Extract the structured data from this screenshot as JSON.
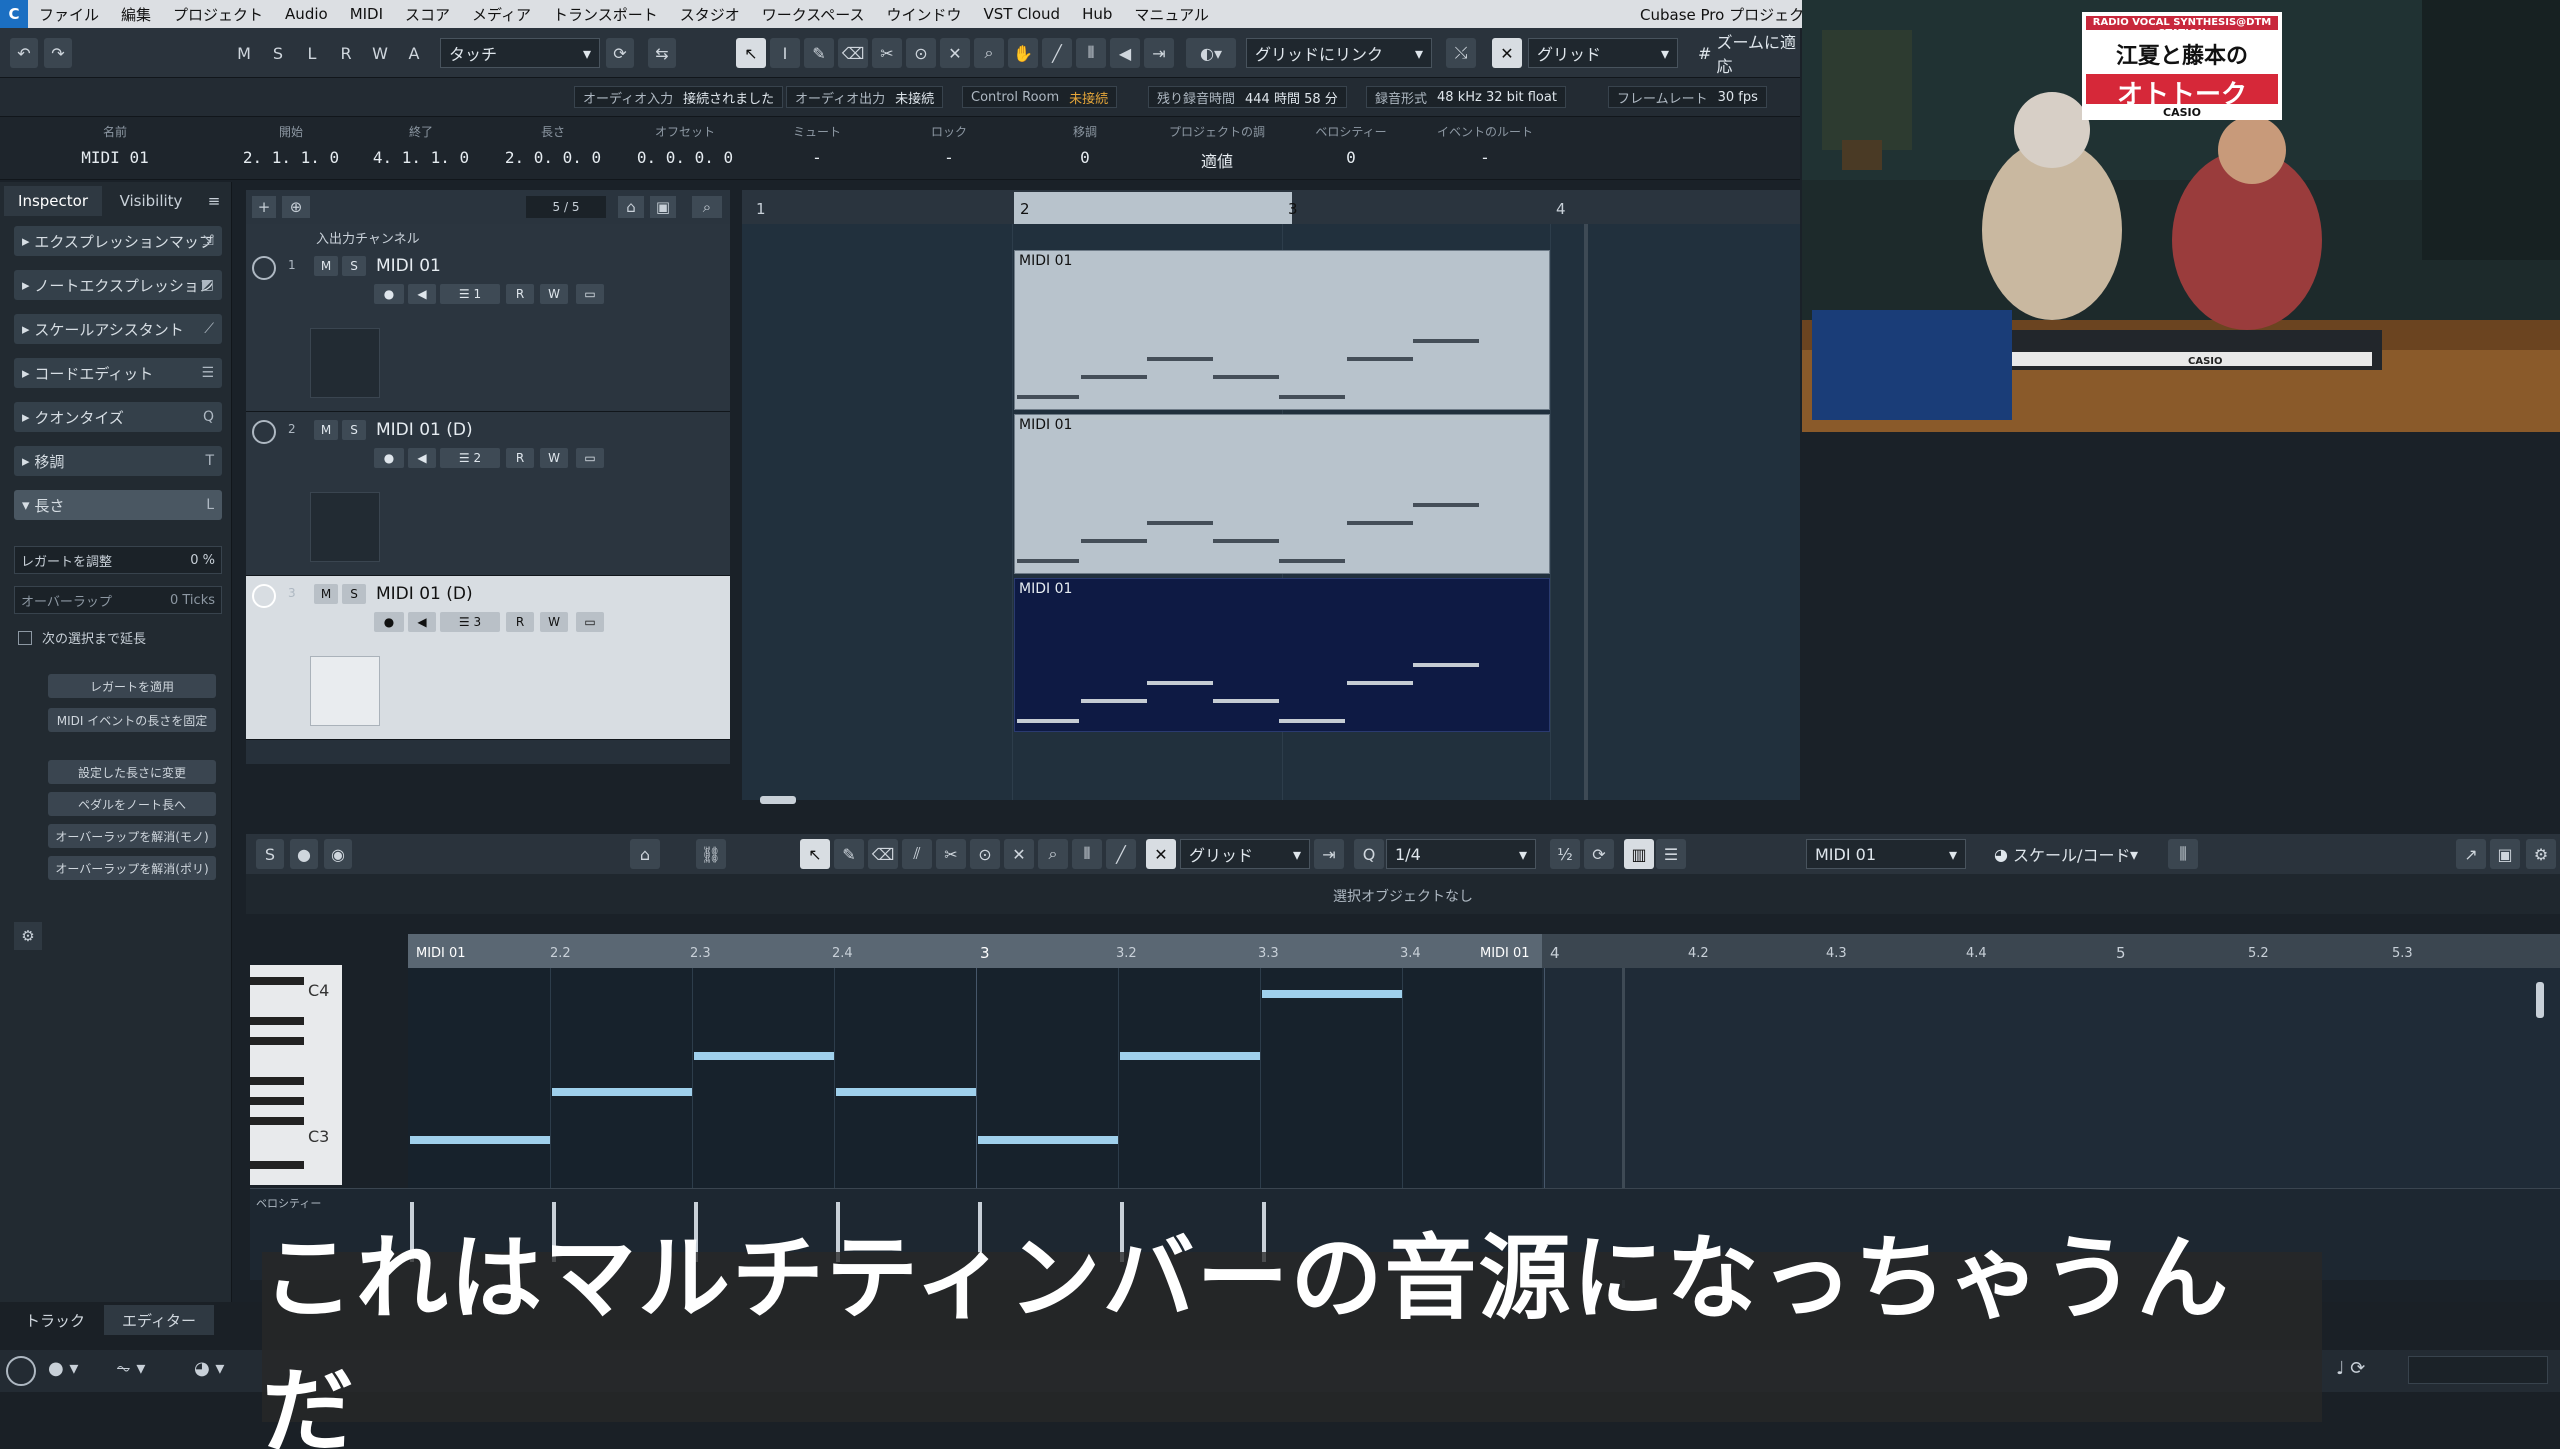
{
  "menubar": {
    "items": [
      "ファイル",
      "編集",
      "プロジェクト",
      "Audio",
      "MIDI",
      "スコア",
      "メディア",
      "トランスポート",
      "スタジオ",
      "ワークスペース",
      "ウインドウ",
      "VST Cloud",
      "Hub",
      "マニュアル"
    ],
    "app_title": "Cubase Pro プロジェクト"
  },
  "toolbar": {
    "state_buttons": [
      "M",
      "S",
      "L",
      "R",
      "W",
      "A"
    ],
    "automation_mode": "タッチ",
    "snap_mode": "グリッドにリンク",
    "grid_type": "グリッド",
    "zoom_label": "ズームに適応"
  },
  "status_line": [
    {
      "label": "オーディオ入力",
      "value": "接続されました",
      "warn": false
    },
    {
      "label": "オーディオ出力",
      "value": "未接続",
      "warn": false
    },
    {
      "label": "Control Room",
      "value": "未接続",
      "warn": true
    },
    {
      "label": "残り録音時間",
      "value": "444 時間 58 分",
      "warn": false
    },
    {
      "label": "録音形式",
      "value": "48 kHz  32 bit float",
      "warn": false
    },
    {
      "label": "フレームレート",
      "value": "30 fps",
      "warn": false
    }
  ],
  "infoline": [
    {
      "label": "名前",
      "value": "MIDI 01"
    },
    {
      "label": "開始",
      "value": "2. 1. 1.  0"
    },
    {
      "label": "終了",
      "value": "4. 1. 1.  0"
    },
    {
      "label": "長さ",
      "value": "2. 0. 0.  0"
    },
    {
      "label": "オフセット",
      "value": "0. 0. 0.  0"
    },
    {
      "label": "ミュート",
      "value": "-"
    },
    {
      "label": "ロック",
      "value": "-"
    },
    {
      "label": "移調",
      "value": "0"
    },
    {
      "label": "プロジェクトの調",
      "value": "適値"
    },
    {
      "label": "ベロシティー",
      "value": "0"
    },
    {
      "label": "イベントのルート",
      "value": "-"
    }
  ],
  "inspector": {
    "tabs": [
      "Inspector",
      "Visibility"
    ],
    "sections": [
      "エクスプレッションマップ",
      "ノートエクスプレッション",
      "スケールアシスタント",
      "コードエディット",
      "クオンタイズ",
      "移調",
      "長さ"
    ],
    "legato_label": "レガートを調整",
    "legato_value": "0 %",
    "overlap_label": "オーバーラップ",
    "overlap_value": "0 Ticks",
    "checkbox_label": "次の選択まで延長",
    "buttons": [
      "レガートを適用",
      "MIDI イベントの長さを固定",
      "設定した長さに変更",
      "ペダルをノート長へ",
      "オーバーラップを解消(モノ)",
      "オーバーラップを解消(ポリ)"
    ]
  },
  "tracklist": {
    "count": "5 / 5",
    "folder": "入出力チャンネル",
    "tracks": [
      {
        "num": "1",
        "name": "MIDI 01",
        "channel": "1"
      },
      {
        "num": "2",
        "name": "MIDI 01 (D)",
        "channel": "2"
      },
      {
        "num": "3",
        "name": "MIDI 01 (D)",
        "channel": "3"
      }
    ]
  },
  "ruler_top": [
    "1",
    "2",
    "3",
    "4"
  ],
  "parts": [
    {
      "name": "MIDI 01"
    },
    {
      "name": "MIDI 01"
    },
    {
      "name": "MIDI 01"
    }
  ],
  "lower": {
    "grid_type": "グリッド",
    "quantize": "1/4",
    "part_select": "MIDI 01",
    "scale_select": "スケール/コード",
    "status": "選択オブジェクトなし",
    "ruler": [
      "MIDI 01",
      "2.2",
      "2.3",
      "2.4",
      "3",
      "3.2",
      "3.3",
      "3.4",
      "MIDI 01",
      "4",
      "4.2",
      "4.3",
      "4.4",
      "5",
      "5.2",
      "5.3"
    ],
    "key_labels": [
      "C4",
      "C3"
    ],
    "velocity_label": "ベロシティー"
  },
  "footer_tabs": [
    "トラック",
    "エディター"
  ],
  "video": {
    "sign_top": "RADIO VOCAL SYNTHESIS@DTM STATION",
    "sign_main": "江夏と藤本の",
    "sign_big": "オトトーク",
    "sign_sponsor": "CASIO",
    "keyboard_brand": "CASIO"
  },
  "subtitle": "これはマルチティンバーの音源になっちゃうんだ"
}
